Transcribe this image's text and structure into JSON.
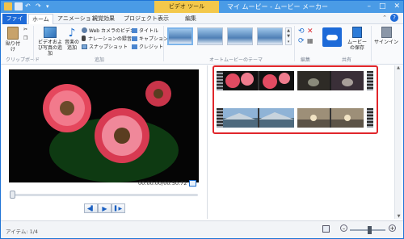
{
  "window": {
    "context_tab": "ビデオ ツール",
    "title": "マイ ムービー - ムービー メーカー"
  },
  "tabs": {
    "file": "ファイル",
    "home": "ホーム",
    "animation": "アニメーション",
    "visual_effects": "視覚効果",
    "project": "プロジェクト",
    "view": "表示",
    "edit": "編集"
  },
  "ribbon": {
    "clipboard": {
      "paste": "貼り付け",
      "group": "クリップボード"
    },
    "add": {
      "add_videos": "ビデオおよび写真の追加",
      "add_music": "音楽の追加",
      "webcam": "Web カメラのビデオ",
      "narration": "ナレーションの録音",
      "snapshot": "スナップショット",
      "title": "タイトル",
      "caption": "キャプション",
      "credits": "クレジット",
      "group": "追加"
    },
    "themes_group": "オートムービーのテーマ",
    "editing_group": "編集",
    "share_group": "共有",
    "save_movie": "ムービーの保存",
    "sign_in": "サインイン"
  },
  "player": {
    "timecode": "00:00.00/00:50.72"
  },
  "status": {
    "items": "アイテム: 1/4"
  },
  "colors": {
    "accent": "#1d6ad8",
    "titlebar": "#4a9be6",
    "context_tab": "#f3c84b",
    "highlight_box": "#e0262b"
  }
}
